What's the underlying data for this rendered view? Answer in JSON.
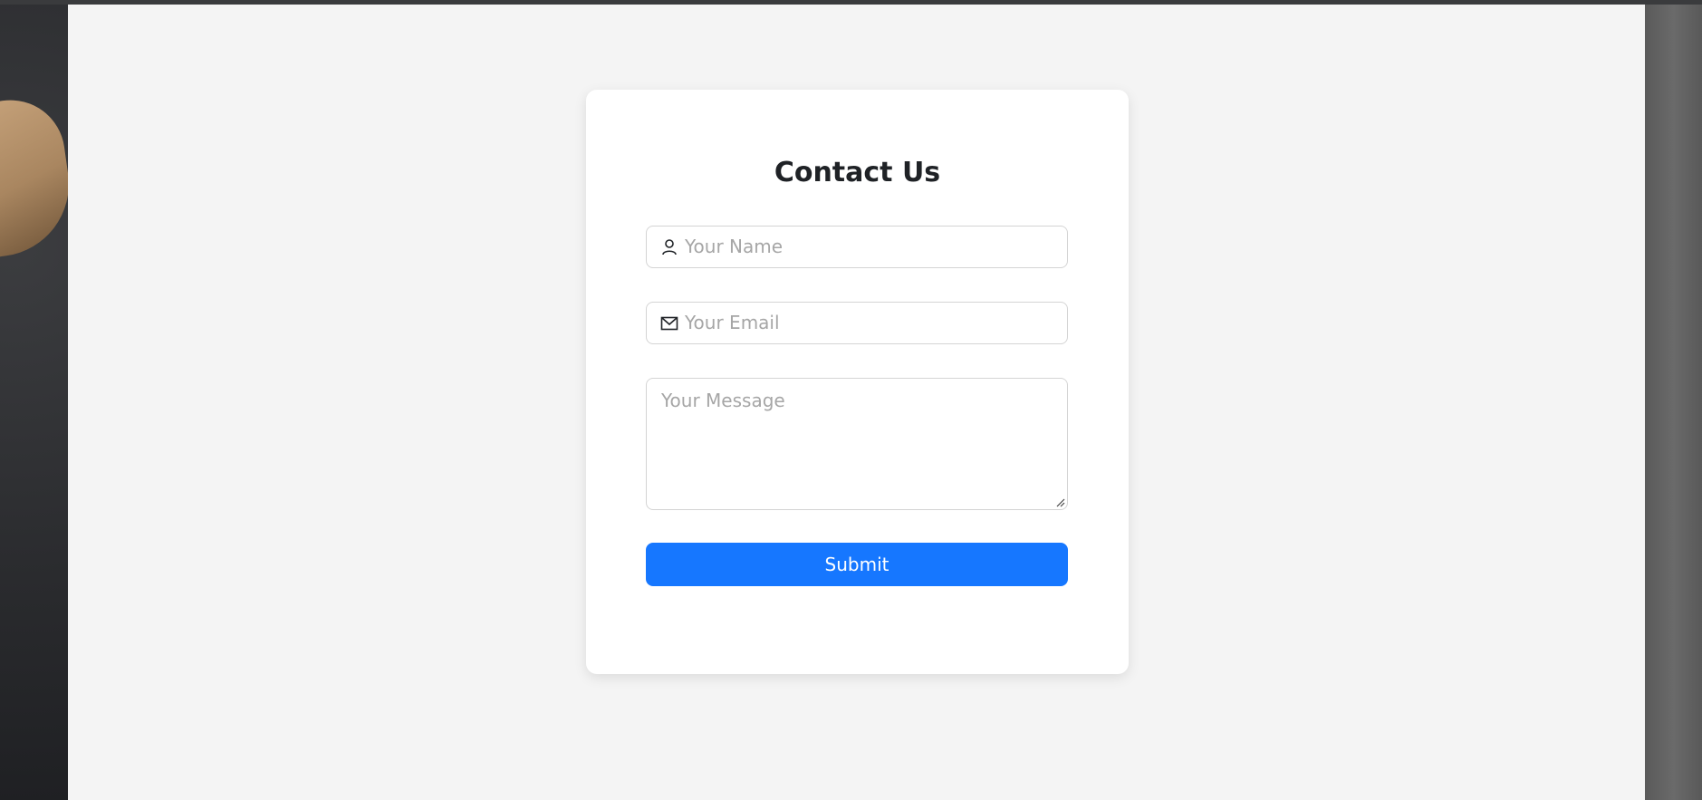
{
  "contact": {
    "title": "Contact Us",
    "name_placeholder": "Your Name",
    "email_placeholder": "Your Email",
    "message_placeholder": "Your Message",
    "submit_label": "Submit"
  },
  "icons": {
    "name": "user-icon",
    "email": "mail-icon",
    "resize": "resize-handle-icon"
  },
  "colors": {
    "submit_button": "#1677ff",
    "page_background": "#f4f4f4",
    "card_background": "#ffffff"
  }
}
